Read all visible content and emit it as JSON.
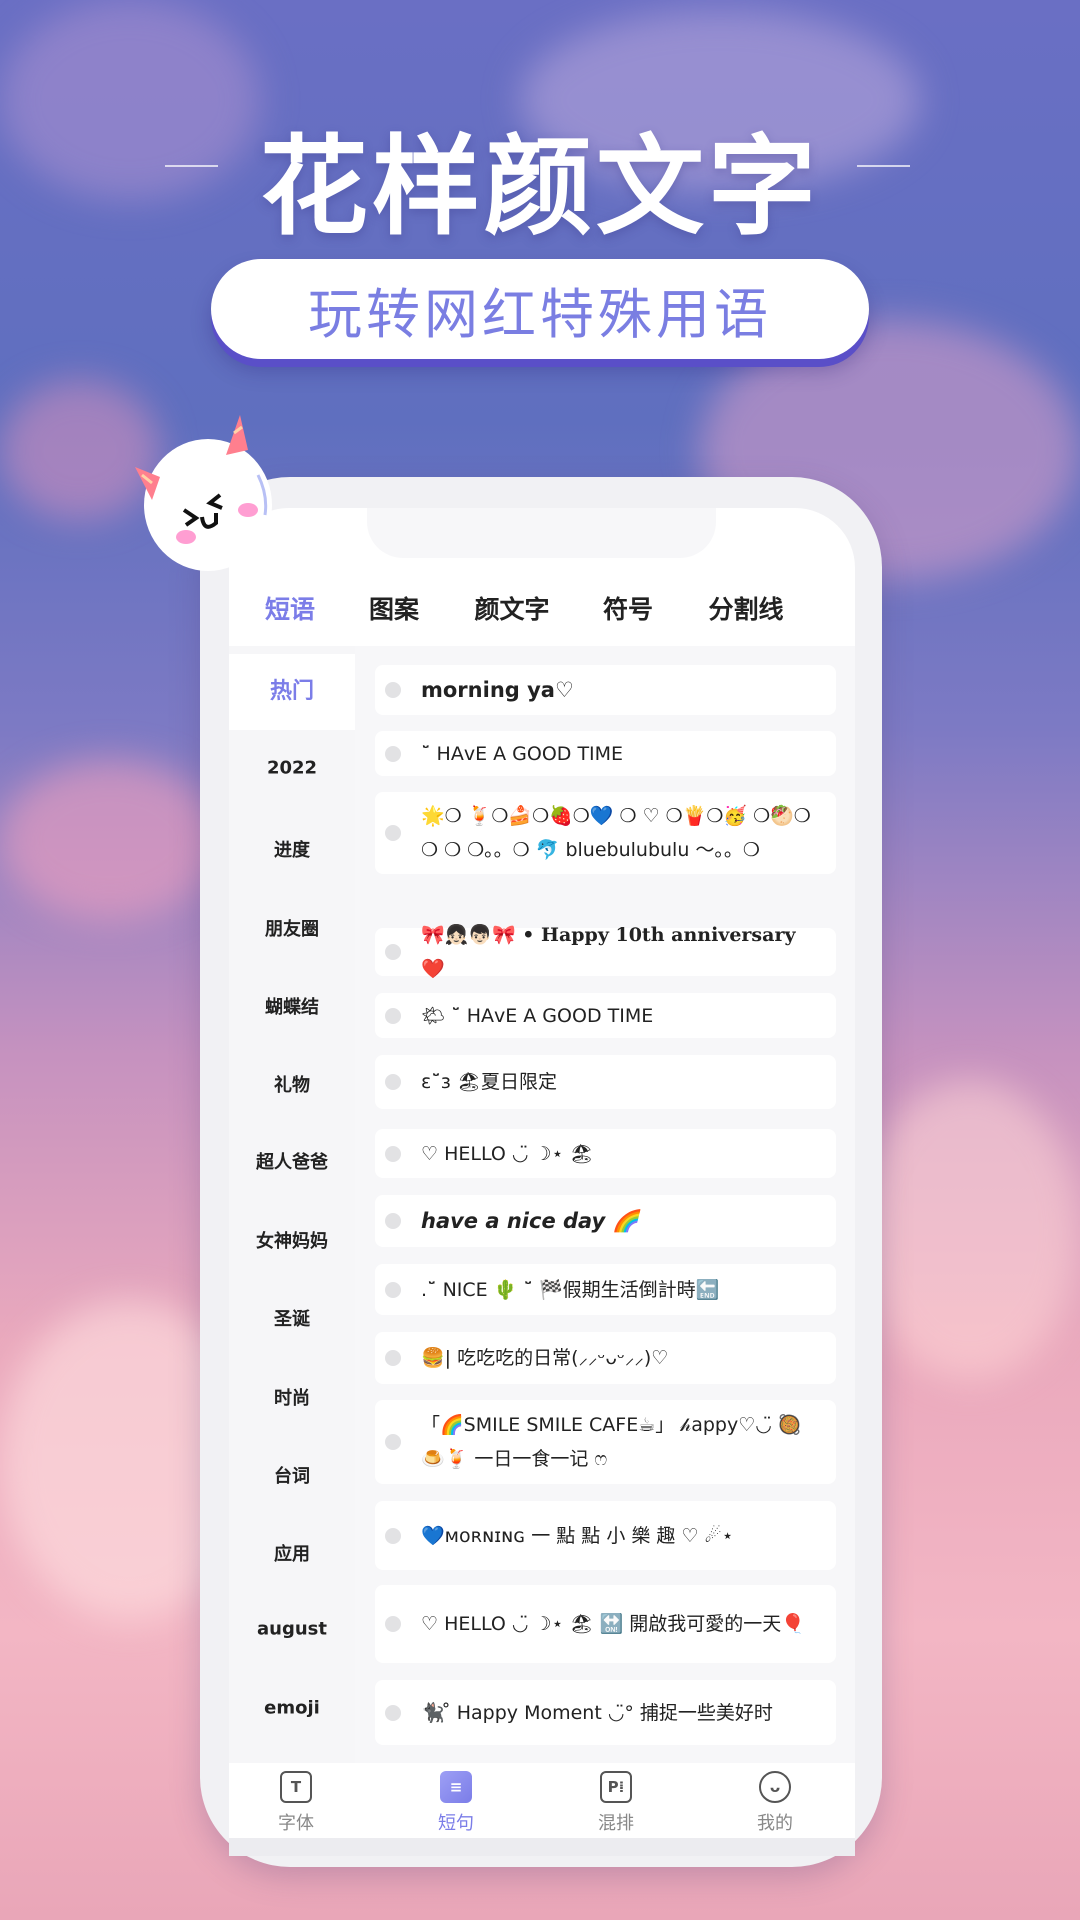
{
  "banner": {
    "title": "花样颜文字",
    "subtitle": "玩转网红特殊用语"
  },
  "colors": {
    "accent": "#7b7de8",
    "subtitle": "#7a7ee2",
    "pill_shadow": "#5a4fc8"
  },
  "mascot": {
    "icon": "devil-mascot-icon"
  },
  "tabs": [
    {
      "label": "短语",
      "active": true
    },
    {
      "label": "图案"
    },
    {
      "label": "颜文字"
    },
    {
      "label": "符号"
    },
    {
      "label": "分割线"
    }
  ],
  "sidebar": [
    {
      "label": "热门",
      "active": true
    },
    {
      "label": "2022"
    },
    {
      "label": "进度"
    },
    {
      "label": "朋友圈"
    },
    {
      "label": "蝴蝶结"
    },
    {
      "label": "礼物"
    },
    {
      "label": "超人爸爸"
    },
    {
      "label": "女神妈妈"
    },
    {
      "label": "圣诞"
    },
    {
      "label": "时尚"
    },
    {
      "label": "台词"
    },
    {
      "label": "应用"
    },
    {
      "label": "august"
    },
    {
      "label": "emoji"
    }
  ],
  "phrases": [
    "morning ya♡",
    "˘̈ HAᴠE A GOOD TIME",
    "🌟❍ 🍹❍🍰❍🍓❍💙 ❍ ♡ ❍🍟❍🥳 ❍🥙❍ ❍ ❍ ❍。。❍ 🐬 bluebulubulu ～。。❍",
    "🎀👧🏻👦🏻🎀 • Happy 10th anniversary ❤️",
    "🌤 ˘̈ HAᴠE A GOOD TIME",
    "ɛ˘̈ɜ 🏖夏日限定",
    "♡ HELLO ◡̈ ☽⋆ 🏖",
    "have a nice day 🌈",
    ".˘̈ NICE 🌵 ˘̈ 🏁假期生活倒計時🔚",
    "🍔| 吃吃吃的日常(⸝⸝ᵕᴗᵕ⸝⸝)♡",
    "「🌈SMILE SMILE CAFE☕」 𝒽appy♡◡̈ 🥘 🍮🍹 一日一食一记 ෆ",
    "💙ᴍᴏʀɴɪɴɢ 一 點 點 小 樂 趣 ♡ ☄︎⋆",
    "♡ HELLO ◡̈ ☽⋆ 🏖 🔛 開啟我可愛的一天🎈",
    "🐈‍⬛ ̊ Happy Moment ◡̈° 捕捉一些美好时"
  ],
  "bottom_nav": [
    {
      "label": "字体",
      "icon": "font-icon",
      "glyph": "T"
    },
    {
      "label": "短句",
      "icon": "phrase-icon",
      "glyph": "≡",
      "active": true
    },
    {
      "label": "混排",
      "icon": "mix-icon",
      "glyph": "P⁞"
    },
    {
      "label": "我的",
      "icon": "bear-profile-icon",
      "glyph": "ᴗ"
    }
  ]
}
